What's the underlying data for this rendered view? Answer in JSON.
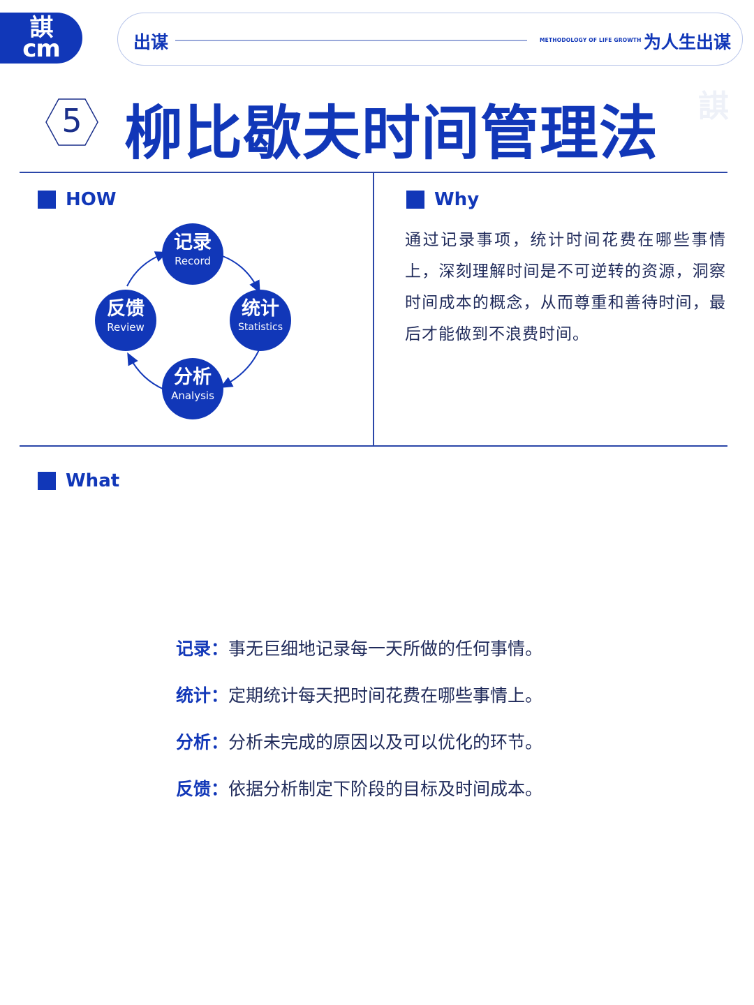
{
  "colors": {
    "accent": "#1137b8"
  },
  "header": {
    "logo_line1": "諆",
    "logo_line2": "cm",
    "left_label": "出谋",
    "small_caption": "METHODOLOGY OF LIFE GROWTH",
    "right_label": "为人生出谋"
  },
  "title_section": {
    "number": "5",
    "title": "柳比歇夫时间管理法",
    "watermark": "諆"
  },
  "how": {
    "heading": "HOW",
    "cycle": [
      {
        "zh": "记录",
        "en": "Record"
      },
      {
        "zh": "统计",
        "en": "Statistics"
      },
      {
        "zh": "分析",
        "en": "Analysis"
      },
      {
        "zh": "反馈",
        "en": "Review"
      }
    ]
  },
  "why": {
    "heading": "Why",
    "text": "通过记录事项，统计时间花费在哪些事情上，深刻理解时间是不可逆转的资源，洞察时间成本的概念，从而尊重和善待时间，最后才能做到不浪费时间。"
  },
  "what": {
    "heading": "What",
    "items": [
      {
        "key": "记录：",
        "text": "事无巨细地记录每一天所做的任何事情。"
      },
      {
        "key": "统计：",
        "text": "定期统计每天把时间花费在哪些事情上。"
      },
      {
        "key": "分析：",
        "text": "分析未完成的原因以及可以优化的环节。"
      },
      {
        "key": "反馈：",
        "text": "依据分析制定下阶段的目标及时间成本。"
      }
    ]
  }
}
